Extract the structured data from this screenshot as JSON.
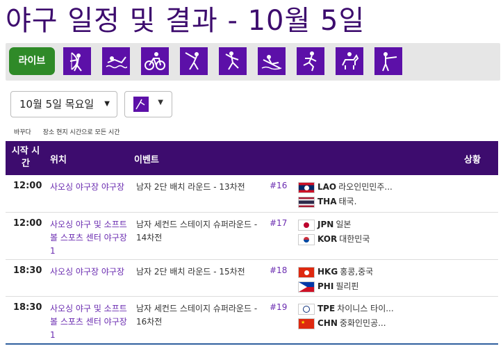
{
  "page": {
    "title": "야구 일정 및 결과 - 10월 5일"
  },
  "sport_bar": {
    "live_label": "라이브",
    "icons": [
      "archery-icon",
      "swimming-icon",
      "cycling-icon",
      "fencing-icon",
      "gymnastics-icon",
      "rowing-icon",
      "athletics-icon",
      "equestrian-icon",
      "shooting-icon"
    ]
  },
  "filters": {
    "date_value": "10월 5일 목요일",
    "sport_icon": "sport-selector-icon"
  },
  "timezone": {
    "change_label": "바꾸다",
    "mode_label": "장소 현지 시간으로 모든 시간"
  },
  "table": {
    "headers": {
      "time": "시작 시간",
      "venue": "위치",
      "event": "이벤트",
      "status": "상황"
    },
    "rows": [
      {
        "time": "12:00",
        "venue": "사오싱 야구장 야구장",
        "event": "남자 2단 배치 라운드 - 13차전",
        "num": "#16",
        "team1": {
          "code": "LAO",
          "name": "라오인민민주...",
          "flag": "lao"
        },
        "team2": {
          "code": "THA",
          "name": "태국.",
          "flag": "tha"
        }
      },
      {
        "time": "12:00",
        "venue": "사오싱 야구 및 소프트볼 스포츠 센터 야구장 1",
        "event": "남자 세컨드 스테이지 슈퍼라운드 - 14차전",
        "num": "#17",
        "team1": {
          "code": "JPN",
          "name": "일본",
          "flag": "jpn"
        },
        "team2": {
          "code": "KOR",
          "name": "대한민국",
          "flag": "kor"
        }
      },
      {
        "time": "18:30",
        "venue": "사오싱 야구장 야구장",
        "event": "남자 2단 배치 라운드 - 15차전",
        "num": "#18",
        "team1": {
          "code": "HKG",
          "name": "홍콩,중국",
          "flag": "hkg"
        },
        "team2": {
          "code": "PHI",
          "name": "필리핀",
          "flag": "phi"
        }
      },
      {
        "time": "18:30",
        "venue": "사오싱 야구 및 소프트볼 스포츠 센터 야구장 1",
        "event": "남자 세컨드 스테이지 슈퍼라운드 - 16차전",
        "num": "#19",
        "team1": {
          "code": "TPE",
          "name": "차이니스 타이...",
          "flag": "tpe"
        },
        "team2": {
          "code": "CHN",
          "name": "중화인민공...",
          "flag": "chn"
        }
      }
    ]
  },
  "colors": {
    "brand_purple": "#3d0c6e",
    "icon_purple": "#5c10a8",
    "live_green": "#2f8a28",
    "link_purple": "#6a2bb0"
  }
}
